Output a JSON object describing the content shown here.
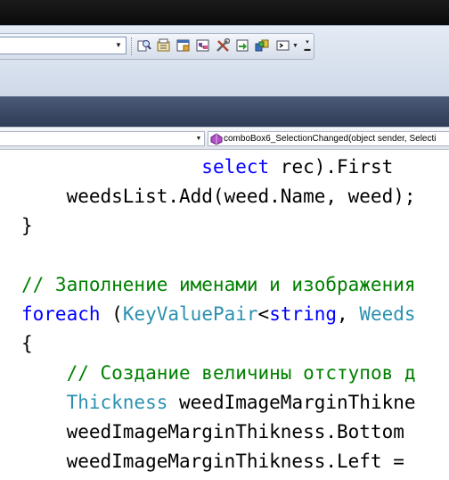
{
  "colors": {
    "keyword": "#0000ff",
    "type": "#2b91af",
    "comment": "#008000",
    "plain": "#000000"
  },
  "toolbar": {
    "config_combo_value": "",
    "buttons": [
      "find-icon",
      "properties-icon",
      "object-browser-icon",
      "class-view-icon",
      "tools-icon",
      "start-page-icon",
      "extension-manager-icon",
      "command-window-icon"
    ]
  },
  "navbar": {
    "type_combo": "",
    "member_combo": "comboBox6_SelectionChanged(object sender, Selecti"
  },
  "code": {
    "lines": [
      [
        {
          "t": "                ",
          "k": "p"
        },
        {
          "t": "select",
          "k": "kw"
        },
        {
          "t": " rec).First",
          "k": "p"
        }
      ],
      [
        {
          "t": "    weedsList.Add(weed.Name, weed);",
          "k": "p"
        }
      ],
      [
        {
          "t": "}",
          "k": "p"
        }
      ],
      [
        {
          "t": "",
          "k": "p"
        }
      ],
      [
        {
          "t": "// Заполнение именами и изображения",
          "k": "cm"
        }
      ],
      [
        {
          "t": "foreach",
          "k": "kw"
        },
        {
          "t": " (",
          "k": "p"
        },
        {
          "t": "KeyValuePair",
          "k": "ty"
        },
        {
          "t": "<",
          "k": "p"
        },
        {
          "t": "string",
          "k": "kw"
        },
        {
          "t": ", ",
          "k": "p"
        },
        {
          "t": "Weeds",
          "k": "ty"
        }
      ],
      [
        {
          "t": "{",
          "k": "p"
        }
      ],
      [
        {
          "t": "    ",
          "k": "p"
        },
        {
          "t": "// Создание величины отступов д",
          "k": "cm"
        }
      ],
      [
        {
          "t": "    ",
          "k": "p"
        },
        {
          "t": "Thickness",
          "k": "ty"
        },
        {
          "t": " weedImageMarginThikne",
          "k": "p"
        }
      ],
      [
        {
          "t": "    weedImageMarginThikness.Bottom",
          "k": "p"
        }
      ],
      [
        {
          "t": "    weedImageMarginThikness.Left =",
          "k": "p"
        }
      ]
    ]
  }
}
